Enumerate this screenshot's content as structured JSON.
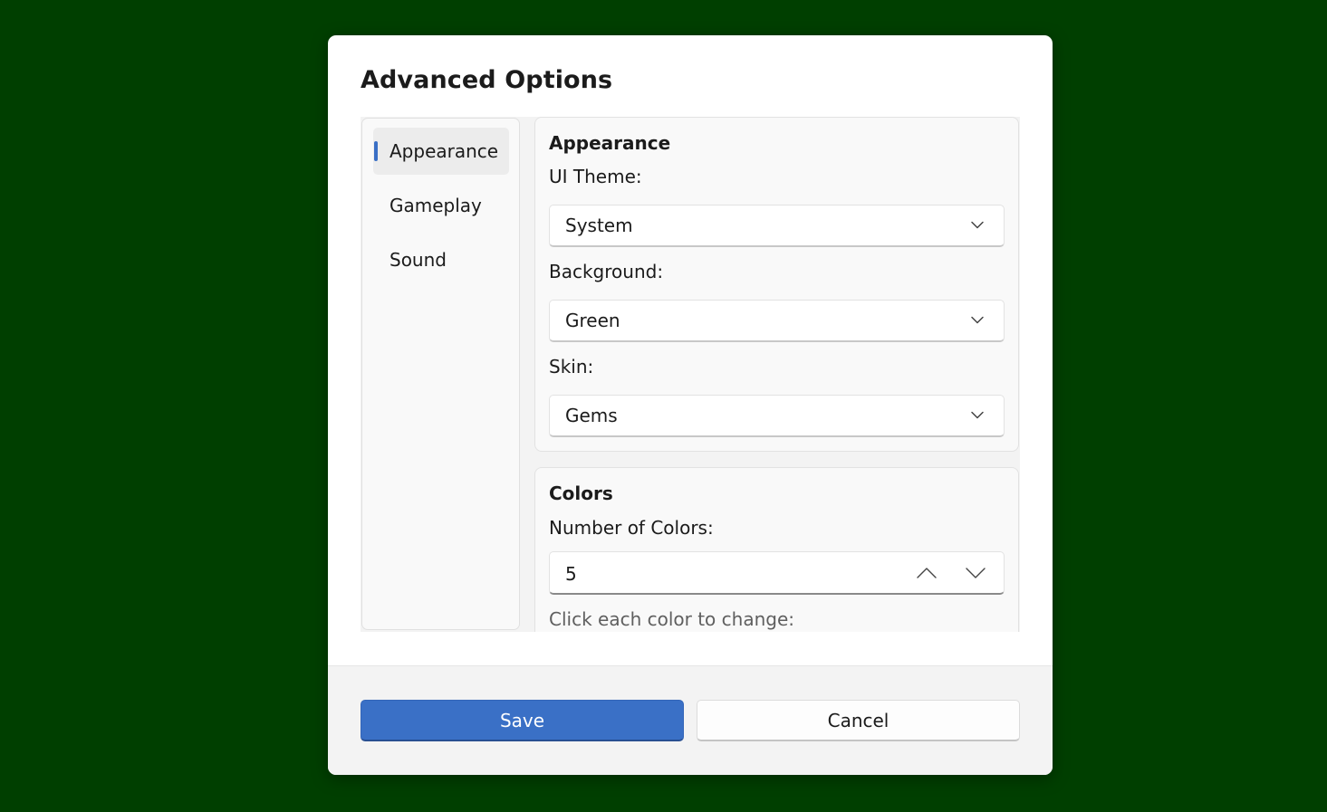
{
  "colors": {
    "background": "#003f00",
    "accent": "#3a70c6"
  },
  "dialog": {
    "title": "Advanced Options"
  },
  "nav": {
    "items": [
      {
        "label": "Appearance",
        "selected": true
      },
      {
        "label": "Gameplay",
        "selected": false
      },
      {
        "label": "Sound",
        "selected": false
      }
    ]
  },
  "appearance_card": {
    "title": "Appearance",
    "ui_theme": {
      "label": "UI Theme:",
      "value": "System",
      "icon": "chevron-down-icon"
    },
    "background": {
      "label": "Background:",
      "value": "Green",
      "icon": "chevron-down-icon"
    },
    "skin": {
      "label": "Skin:",
      "value": "Gems",
      "icon": "chevron-down-icon"
    }
  },
  "colors_card": {
    "title": "Colors",
    "number_label": "Number of Colors:",
    "number_value": "5",
    "hint": "Click each color to change:"
  },
  "footer": {
    "save_label": "Save",
    "cancel_label": "Cancel"
  }
}
